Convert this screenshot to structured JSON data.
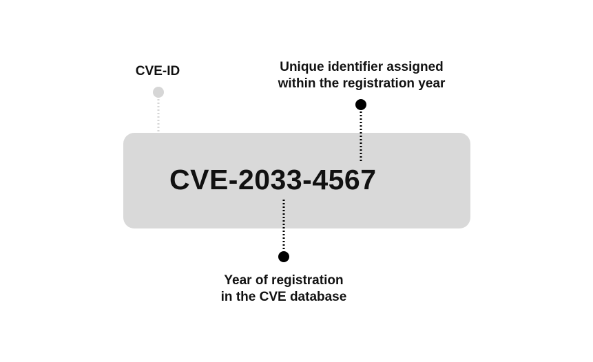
{
  "diagram": {
    "cve_id": "CVE-2033-4567",
    "labels": {
      "prefix": "CVE-ID",
      "unique_line1": "Unique identifier assigned",
      "unique_line2": "within the registration year",
      "year_line1": "Year of registration",
      "year_line2": "in the CVE database"
    },
    "colors": {
      "box": "#d9d9d9",
      "text": "#111111",
      "prefix_marker": "#d6d6d6",
      "marker": "#000000"
    }
  }
}
